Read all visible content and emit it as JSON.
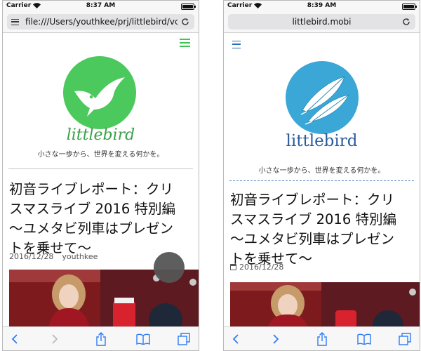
{
  "left": {
    "status": {
      "carrier": "Carrier",
      "time": "8:37 AM"
    },
    "url": "file:///Users/youthkee/prj/littlebird/vcc",
    "site": {
      "title": "littlebird",
      "tagline": "小さな一歩から、世界を変える何かを。"
    },
    "post": {
      "title_lines": [
        "初音ライブレポート：クリ",
        "スマスライブ 2016 特別編",
        "〜ユメタビ列車はプレゼン",
        "トを乗せて〜"
      ],
      "date": "2016/12/28",
      "author": "youthkee"
    }
  },
  "right": {
    "status": {
      "carrier": "Carrier",
      "time": "8:39 AM"
    },
    "url": "littlebird.mobi",
    "site": {
      "title": "littlebird",
      "tagline": "小さな一歩から、世界を変える何かを。"
    },
    "post": {
      "title_lines": [
        "初音ライブレポート：クリ",
        "スマスライブ 2016 特別編",
        "〜ユメタビ列車はプレゼン",
        "トを乗せて〜"
      ],
      "date": "2016/12/28"
    }
  },
  "icons": {
    "back": "back-icon",
    "forward": "forward-icon",
    "share": "share-icon",
    "bookmarks": "bookmarks-icon",
    "tabs": "tabs-icon",
    "menu": "hamburger-icon",
    "reload": "reload-icon",
    "wifi": "wifi-icon",
    "battery": "battery-icon",
    "calendar": "calendar-icon"
  },
  "colors": {
    "left_accent": "#4cc95c",
    "right_accent": "#3aa7d6",
    "right_title": "#2a5b9c",
    "ios_blue": "#2f7bf6"
  }
}
